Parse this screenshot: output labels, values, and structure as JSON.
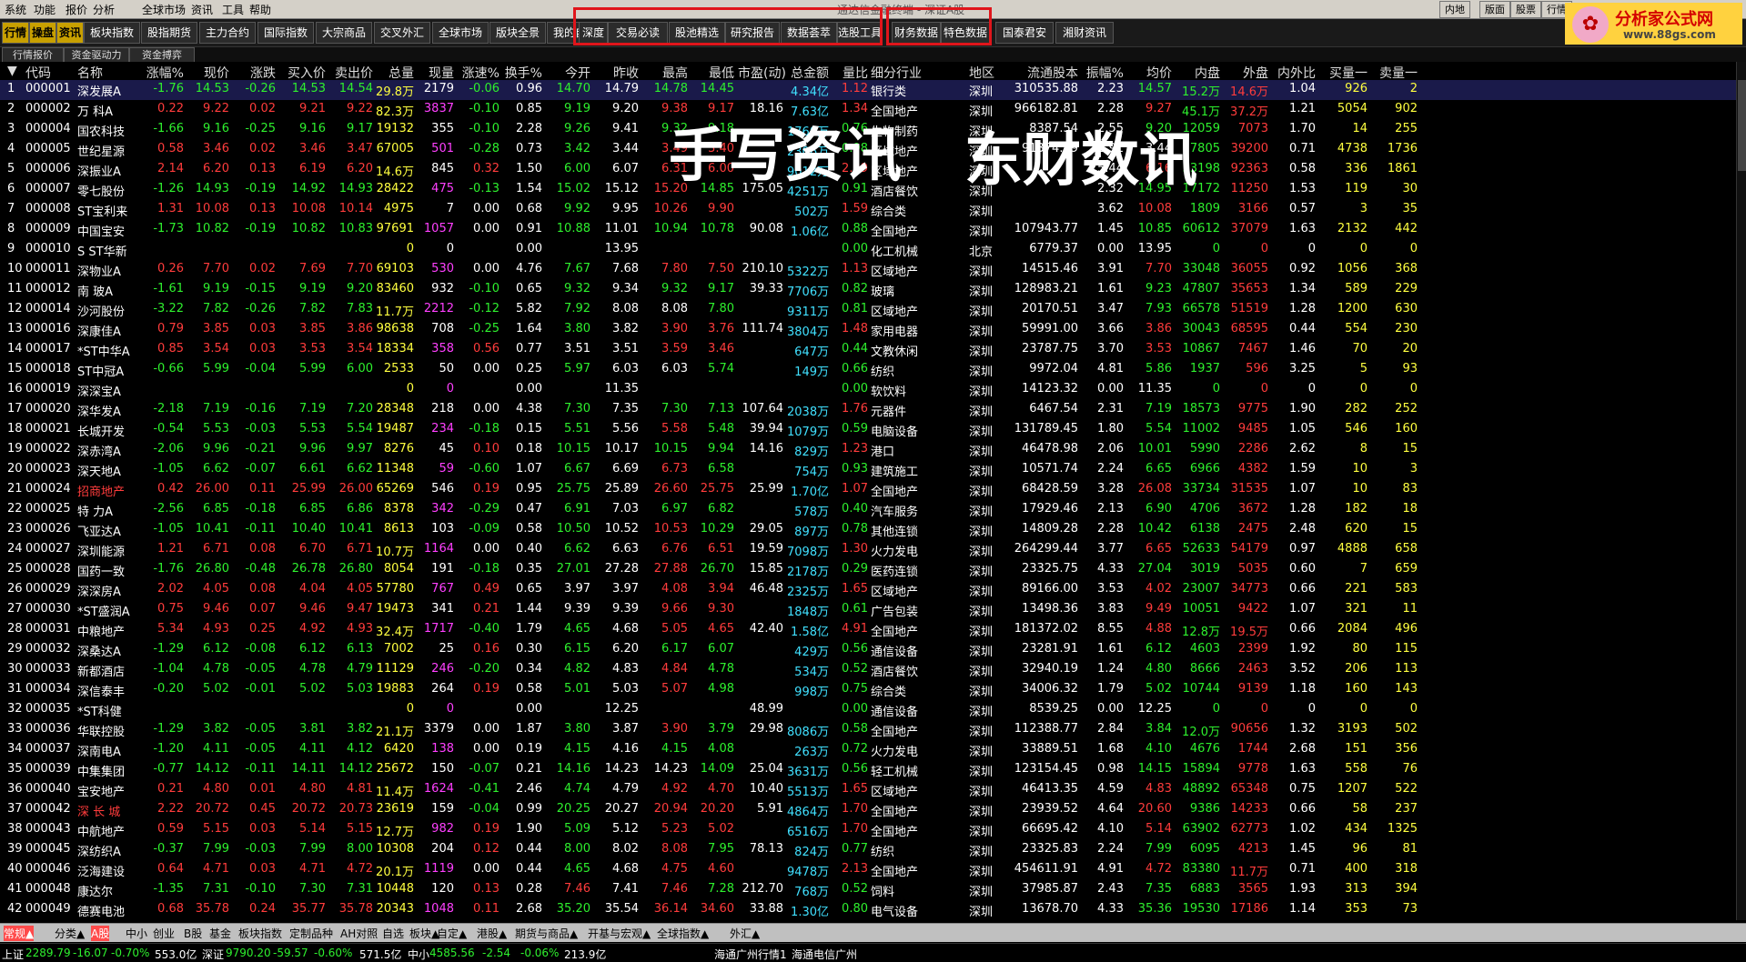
{
  "app": {
    "title": "通达信金融终端 - 深证A股"
  },
  "menu": [
    "系统",
    "功能",
    "报价",
    "分析",
    "全球市场",
    "资讯",
    "工具",
    "帮助"
  ],
  "window_buttons": [
    "内地手",
    "版面",
    "股票",
    "行情"
  ],
  "logo": {
    "text": "分析家公式网",
    "url": "www.88gs.com"
  },
  "toolbar": {
    "left": [
      "行情",
      "操盘",
      "资讯",
      "板块指数",
      "股指期货",
      "主力合约",
      "国际指数",
      "大宗商品",
      "交叉外汇",
      "全球市场",
      "版块全景",
      "我的自选"
    ],
    "box1": [
      "深度",
      "交易必读",
      "股池精选",
      "研究报告",
      "数据荟萃",
      "选股工具"
    ],
    "box2": [
      "财务数据",
      "特色数据"
    ],
    "right": [
      "国泰君安",
      "湘财资讯"
    ]
  },
  "subtabs": [
    "行情报价",
    "资金驱动力",
    "资金搏弈"
  ],
  "annotations": {
    "left": "手写资讯",
    "right": "东财数讯"
  },
  "columns": [
    "",
    "代码",
    "名称",
    "涨幅%",
    "现价",
    "涨跌",
    "买入价",
    "卖出价",
    "总量",
    "现量",
    "涨速%",
    "换手%",
    "今开",
    "昨收",
    "最高",
    "最低",
    "市盈(动)",
    "总金额",
    "量比",
    "细分行业",
    "地区",
    "流通股本",
    "振幅%",
    "均价",
    "内盘",
    "外盘",
    "内外比",
    "买量一",
    "卖量一"
  ],
  "rows": [
    [
      "1",
      "000001",
      "深发展A",
      "-1.76",
      "14.53",
      "-0.26",
      "14.53",
      "14.54",
      "29.8万",
      "2179",
      "-0.06",
      "0.96",
      "14.70",
      "14.79",
      "14.78",
      "14.45",
      "",
      "4.34亿",
      "1.12",
      "银行类",
      "深圳",
      "310535.88",
      "2.23",
      "14.57",
      "15.2万",
      "14.6万",
      "1.04",
      "926",
      "2"
    ],
    [
      "2",
      "000002",
      "万 科A",
      "0.22",
      "9.22",
      "0.02",
      "9.21",
      "9.22",
      "82.3万",
      "3837",
      "-0.10",
      "0.85",
      "9.19",
      "9.20",
      "9.38",
      "9.17",
      "18.16",
      "7.63亿",
      "1.34",
      "全国地产",
      "深圳",
      "966182.81",
      "2.28",
      "9.27",
      "45.1万",
      "37.2万",
      "1.21",
      "5054",
      "902"
    ],
    [
      "3",
      "000004",
      "国农科技",
      "-1.66",
      "9.16",
      "-0.25",
      "9.16",
      "9.17",
      "19132",
      "355",
      "-0.10",
      "2.28",
      "9.26",
      "9.41",
      "9.32",
      "9.18",
      "",
      "1760万",
      "0.76",
      "生物制药",
      "深圳",
      "8387.54",
      "2.55",
      "9.20",
      "12059",
      "7073",
      "1.70",
      "14",
      "255"
    ],
    [
      "4",
      "000005",
      "世纪星源",
      "0.58",
      "3.46",
      "0.02",
      "3.46",
      "3.47",
      "67005",
      "501",
      "-0.28",
      "0.73",
      "3.42",
      "3.44",
      "3.49",
      "3.40",
      "",
      "2306万",
      "0.98",
      "区域地产",
      "深圳",
      "91374.29",
      "2.91",
      "3.44",
      "27805",
      "39200",
      "0.71",
      "4738",
      "1736"
    ],
    [
      "5",
      "000006",
      "深振业A",
      "2.14",
      "6.20",
      "0.13",
      "6.19",
      "6.20",
      "14.6万",
      "845",
      "0.32",
      "1.50",
      "6.00",
      "6.07",
      "6.31",
      "6.00",
      "",
      "9012万",
      "2.39",
      "区域地产",
      "深圳",
      "",
      "5.44",
      "6.16",
      "53198",
      "92363",
      "0.58",
      "336",
      "1861"
    ],
    [
      "6",
      "000007",
      "零七股份",
      "-1.26",
      "14.93",
      "-0.19",
      "14.92",
      "14.93",
      "28422",
      "475",
      "-0.13",
      "1.54",
      "15.02",
      "15.12",
      "15.20",
      "14.85",
      "175.05",
      "4251万",
      "0.91",
      "酒店餐饮",
      "深圳",
      "",
      "2.32",
      "14.95",
      "17172",
      "11250",
      "1.53",
      "119",
      "30"
    ],
    [
      "7",
      "000008",
      "ST宝利来",
      "1.31",
      "10.08",
      "0.13",
      "10.08",
      "10.14",
      "4975",
      "7",
      "0.00",
      "0.68",
      "9.92",
      "9.95",
      "10.26",
      "9.90",
      "",
      "502万",
      "1.59",
      "综合类",
      "深圳",
      "",
      "3.62",
      "10.08",
      "1809",
      "3166",
      "0.57",
      "3",
      "35"
    ],
    [
      "8",
      "000009",
      "中国宝安",
      "-1.73",
      "10.82",
      "-0.19",
      "10.82",
      "10.83",
      "97691",
      "1057",
      "0.00",
      "0.91",
      "10.88",
      "11.01",
      "10.94",
      "10.78",
      "90.08",
      "1.06亿",
      "0.88",
      "全国地产",
      "深圳",
      "107943.77",
      "1.45",
      "10.85",
      "60612",
      "37079",
      "1.63",
      "2132",
      "442"
    ],
    [
      "9",
      "000010",
      "S ST华新",
      "",
      "",
      "",
      "",
      "",
      "0",
      "0",
      "",
      "0.00",
      "",
      "13.95",
      "",
      "",
      "",
      "",
      "0.00",
      "化工机械",
      "北京",
      "6779.37",
      "0.00",
      "13.95",
      "0",
      "0",
      "0",
      "0",
      "0"
    ],
    [
      "10",
      "000011",
      "深物业A",
      "0.26",
      "7.70",
      "0.02",
      "7.69",
      "7.70",
      "69103",
      "530",
      "0.00",
      "4.76",
      "7.67",
      "7.68",
      "7.80",
      "7.50",
      "210.10",
      "5322万",
      "1.13",
      "区域地产",
      "深圳",
      "14515.46",
      "3.91",
      "7.70",
      "33048",
      "36055",
      "0.92",
      "1056",
      "368"
    ],
    [
      "11",
      "000012",
      "南 玻A",
      "-1.61",
      "9.19",
      "-0.15",
      "9.19",
      "9.20",
      "83460",
      "932",
      "-0.10",
      "0.65",
      "9.32",
      "9.34",
      "9.32",
      "9.17",
      "39.33",
      "7706万",
      "0.82",
      "玻璃",
      "深圳",
      "128983.21",
      "1.61",
      "9.23",
      "47807",
      "35653",
      "1.34",
      "589",
      "229"
    ],
    [
      "12",
      "000014",
      "沙河股份",
      "-3.22",
      "7.82",
      "-0.26",
      "7.82",
      "7.83",
      "11.7万",
      "2212",
      "-0.12",
      "5.82",
      "7.92",
      "8.08",
      "8.08",
      "7.80",
      "",
      "9311万",
      "0.81",
      "区域地产",
      "深圳",
      "20170.51",
      "3.47",
      "7.93",
      "66578",
      "51519",
      "1.28",
      "1200",
      "630"
    ],
    [
      "13",
      "000016",
      "深康佳A",
      "0.79",
      "3.85",
      "0.03",
      "3.85",
      "3.86",
      "98638",
      "708",
      "-0.25",
      "1.64",
      "3.80",
      "3.82",
      "3.90",
      "3.76",
      "111.74",
      "3804万",
      "1.48",
      "家用电器",
      "深圳",
      "59991.00",
      "3.66",
      "3.86",
      "30043",
      "68595",
      "0.44",
      "554",
      "230"
    ],
    [
      "14",
      "000017",
      "*ST中华A",
      "0.85",
      "3.54",
      "0.03",
      "3.53",
      "3.54",
      "18334",
      "358",
      "0.56",
      "0.77",
      "3.51",
      "3.51",
      "3.59",
      "3.46",
      "",
      "647万",
      "0.44",
      "文教休闲",
      "深圳",
      "23787.75",
      "3.70",
      "3.53",
      "10867",
      "7467",
      "1.46",
      "70",
      "20"
    ],
    [
      "15",
      "000018",
      "ST中冠A",
      "-0.66",
      "5.99",
      "-0.04",
      "5.99",
      "6.00",
      "2533",
      "50",
      "0.00",
      "0.25",
      "5.97",
      "6.03",
      "6.03",
      "5.74",
      "",
      "149万",
      "0.66",
      "纺织",
      "深圳",
      "9972.04",
      "4.81",
      "5.86",
      "1937",
      "596",
      "3.25",
      "5",
      "93"
    ],
    [
      "16",
      "000019",
      "深深宝A",
      "",
      "",
      "",
      "",
      "",
      "0",
      "0",
      "",
      "0.00",
      "",
      "11.35",
      "",
      "",
      "",
      "",
      "0.00",
      "软饮料",
      "深圳",
      "14123.32",
      "0.00",
      "11.35",
      "0",
      "0",
      "0",
      "0",
      "0"
    ],
    [
      "17",
      "000020",
      "深华发A",
      "-2.18",
      "7.19",
      "-0.16",
      "7.19",
      "7.20",
      "28348",
      "218",
      "0.00",
      "4.38",
      "7.30",
      "7.35",
      "7.30",
      "7.13",
      "107.64",
      "2038万",
      "1.76",
      "元器件",
      "深圳",
      "6467.54",
      "2.31",
      "7.19",
      "18573",
      "9775",
      "1.90",
      "282",
      "252"
    ],
    [
      "18",
      "000021",
      "长城开发",
      "-0.54",
      "5.53",
      "-0.03",
      "5.53",
      "5.54",
      "19487",
      "234",
      "-0.18",
      "0.15",
      "5.51",
      "5.56",
      "5.58",
      "5.48",
      "39.94",
      "1079万",
      "0.59",
      "电脑设备",
      "深圳",
      "131789.45",
      "1.80",
      "5.54",
      "11002",
      "9485",
      "1.05",
      "546",
      "160"
    ],
    [
      "19",
      "000022",
      "深赤湾A",
      "-2.06",
      "9.96",
      "-0.21",
      "9.96",
      "9.97",
      "8276",
      "45",
      "0.10",
      "0.18",
      "10.15",
      "10.17",
      "10.15",
      "9.94",
      "14.16",
      "829万",
      "1.23",
      "港口",
      "深圳",
      "46478.98",
      "2.06",
      "10.01",
      "5990",
      "2286",
      "2.62",
      "8",
      "15"
    ],
    [
      "20",
      "000023",
      "深天地A",
      "-1.05",
      "6.62",
      "-0.07",
      "6.61",
      "6.62",
      "11348",
      "59",
      "-0.60",
      "1.07",
      "6.67",
      "6.69",
      "6.73",
      "6.58",
      "",
      "754万",
      "0.93",
      "建筑施工",
      "深圳",
      "10571.74",
      "2.24",
      "6.65",
      "6966",
      "4382",
      "1.59",
      "10",
      "3"
    ],
    [
      "21",
      "000024",
      "招商地产",
      "0.42",
      "26.00",
      "0.11",
      "25.99",
      "26.00",
      "65269",
      "546",
      "0.19",
      "0.95",
      "25.75",
      "25.89",
      "26.60",
      "25.75",
      "25.99",
      "1.70亿",
      "1.07",
      "全国地产",
      "深圳",
      "68428.59",
      "3.28",
      "26.08",
      "33734",
      "31535",
      "1.07",
      "10",
      "83"
    ],
    [
      "22",
      "000025",
      "特 力A",
      "-2.56",
      "6.85",
      "-0.18",
      "6.85",
      "6.86",
      "8378",
      "342",
      "-0.29",
      "0.47",
      "6.91",
      "7.03",
      "6.97",
      "6.82",
      "",
      "578万",
      "0.40",
      "汽车服务",
      "深圳",
      "17929.46",
      "2.13",
      "6.90",
      "4706",
      "3672",
      "1.28",
      "182",
      "18"
    ],
    [
      "23",
      "000026",
      "飞亚达A",
      "-1.05",
      "10.41",
      "-0.11",
      "10.40",
      "10.41",
      "8613",
      "103",
      "-0.09",
      "0.58",
      "10.50",
      "10.52",
      "10.53",
      "10.29",
      "29.05",
      "897万",
      "0.78",
      "其他连锁",
      "深圳",
      "14809.28",
      "2.28",
      "10.42",
      "6138",
      "2475",
      "2.48",
      "620",
      "15"
    ],
    [
      "24",
      "000027",
      "深圳能源",
      "1.21",
      "6.71",
      "0.08",
      "6.70",
      "6.71",
      "10.7万",
      "1164",
      "0.00",
      "0.40",
      "6.62",
      "6.63",
      "6.76",
      "6.51",
      "19.59",
      "7098万",
      "1.30",
      "火力发电",
      "深圳",
      "264299.44",
      "3.77",
      "6.65",
      "52633",
      "54179",
      "0.97",
      "4888",
      "658"
    ],
    [
      "25",
      "000028",
      "国药一致",
      "-1.76",
      "26.80",
      "-0.48",
      "26.78",
      "26.80",
      "8054",
      "191",
      "-0.18",
      "0.35",
      "27.01",
      "27.28",
      "27.88",
      "26.70",
      "15.85",
      "2178万",
      "0.29",
      "医药连锁",
      "深圳",
      "23325.75",
      "4.33",
      "27.04",
      "3019",
      "5035",
      "0.60",
      "7",
      "659"
    ],
    [
      "26",
      "000029",
      "深深房A",
      "2.02",
      "4.05",
      "0.08",
      "4.04",
      "4.05",
      "57780",
      "767",
      "0.49",
      "0.65",
      "3.97",
      "3.97",
      "4.08",
      "3.94",
      "46.48",
      "2325万",
      "1.65",
      "区域地产",
      "深圳",
      "89166.00",
      "3.53",
      "4.02",
      "23007",
      "34773",
      "0.66",
      "221",
      "583"
    ],
    [
      "27",
      "000030",
      "*ST盛润A",
      "0.75",
      "9.46",
      "0.07",
      "9.46",
      "9.47",
      "19473",
      "341",
      "0.21",
      "1.44",
      "9.39",
      "9.39",
      "9.66",
      "9.30",
      "",
      "1848万",
      "0.61",
      "广告包装",
      "深圳",
      "13498.36",
      "3.83",
      "9.49",
      "10051",
      "9422",
      "1.07",
      "321",
      "11"
    ],
    [
      "28",
      "000031",
      "中粮地产",
      "5.34",
      "4.93",
      "0.25",
      "4.92",
      "4.93",
      "32.4万",
      "1717",
      "-0.40",
      "1.79",
      "4.65",
      "4.68",
      "5.05",
      "4.65",
      "42.40",
      "1.58亿",
      "4.91",
      "全国地产",
      "深圳",
      "181372.02",
      "8.55",
      "4.88",
      "12.8万",
      "19.5万",
      "0.66",
      "2084",
      "496"
    ],
    [
      "29",
      "000032",
      "深桑达A",
      "-1.29",
      "6.12",
      "-0.08",
      "6.12",
      "6.13",
      "7002",
      "25",
      "0.16",
      "0.30",
      "6.15",
      "6.20",
      "6.17",
      "6.07",
      "",
      "429万",
      "0.56",
      "通信设备",
      "深圳",
      "23281.91",
      "1.61",
      "6.12",
      "4603",
      "2399",
      "1.92",
      "80",
      "115"
    ],
    [
      "30",
      "000033",
      "新都酒店",
      "-1.04",
      "4.78",
      "-0.05",
      "4.78",
      "4.79",
      "11129",
      "246",
      "-0.20",
      "0.34",
      "4.82",
      "4.83",
      "4.84",
      "4.78",
      "",
      "534万",
      "0.52",
      "酒店餐饮",
      "深圳",
      "32940.19",
      "1.24",
      "4.80",
      "8666",
      "2463",
      "3.52",
      "206",
      "113"
    ],
    [
      "31",
      "000034",
      "深信泰丰",
      "-0.20",
      "5.02",
      "-0.01",
      "5.02",
      "5.03",
      "19883",
      "264",
      "0.19",
      "0.58",
      "5.01",
      "5.03",
      "5.07",
      "4.98",
      "",
      "998万",
      "0.75",
      "综合类",
      "深圳",
      "34006.32",
      "1.79",
      "5.02",
      "10744",
      "9139",
      "1.18",
      "160",
      "143"
    ],
    [
      "32",
      "000035",
      "*ST科健",
      "",
      "",
      "",
      "",
      "",
      "0",
      "0",
      "",
      "0.00",
      "",
      "12.25",
      "",
      "",
      "48.99",
      "",
      "0.00",
      "通信设备",
      "深圳",
      "8539.25",
      "0.00",
      "12.25",
      "0",
      "0",
      "0",
      "0",
      "0"
    ],
    [
      "33",
      "000036",
      "华联控股",
      "-1.29",
      "3.82",
      "-0.05",
      "3.81",
      "3.82",
      "21.1万",
      "3379",
      "0.00",
      "1.87",
      "3.80",
      "3.87",
      "3.90",
      "3.79",
      "29.98",
      "8086万",
      "0.58",
      "全国地产",
      "深圳",
      "112388.77",
      "2.84",
      "3.84",
      "12.0万",
      "90656",
      "1.32",
      "3193",
      "502"
    ],
    [
      "34",
      "000037",
      "深南电A",
      "-1.20",
      "4.11",
      "-0.05",
      "4.11",
      "4.12",
      "6420",
      "138",
      "0.00",
      "0.19",
      "4.15",
      "4.16",
      "4.15",
      "4.08",
      "",
      "263万",
      "0.72",
      "火力发电",
      "深圳",
      "33889.51",
      "1.68",
      "4.10",
      "4676",
      "1744",
      "2.68",
      "151",
      "356"
    ],
    [
      "35",
      "000039",
      "中集集团",
      "-0.77",
      "14.12",
      "-0.11",
      "14.11",
      "14.12",
      "25672",
      "150",
      "-0.07",
      "0.21",
      "14.16",
      "14.23",
      "14.23",
      "14.09",
      "25.04",
      "3631万",
      "0.56",
      "轻工机械",
      "深圳",
      "123154.45",
      "0.98",
      "14.15",
      "15894",
      "9778",
      "1.63",
      "558",
      "76"
    ],
    [
      "36",
      "000040",
      "宝安地产",
      "0.21",
      "4.80",
      "0.01",
      "4.80",
      "4.81",
      "11.4万",
      "1624",
      "-0.41",
      "2.46",
      "4.74",
      "4.79",
      "4.92",
      "4.70",
      "10.40",
      "5513万",
      "1.65",
      "区域地产",
      "深圳",
      "46413.35",
      "4.59",
      "4.83",
      "48892",
      "65348",
      "0.75",
      "1207",
      "522"
    ],
    [
      "37",
      "000042",
      "深 长 城",
      "2.22",
      "20.72",
      "0.45",
      "20.72",
      "20.73",
      "23619",
      "159",
      "-0.04",
      "0.99",
      "20.25",
      "20.27",
      "20.94",
      "20.20",
      "5.91",
      "4864万",
      "1.70",
      "全国地产",
      "深圳",
      "23939.52",
      "4.64",
      "20.60",
      "9386",
      "14233",
      "0.66",
      "58",
      "237"
    ],
    [
      "38",
      "000043",
      "中航地产",
      "0.59",
      "5.15",
      "0.03",
      "5.14",
      "5.15",
      "12.7万",
      "982",
      "0.19",
      "1.90",
      "5.09",
      "5.12",
      "5.23",
      "5.02",
      "",
      "6516万",
      "1.70",
      "全国地产",
      "深圳",
      "66695.42",
      "4.10",
      "5.14",
      "63902",
      "62773",
      "1.02",
      "434",
      "1325"
    ],
    [
      "39",
      "000045",
      "深纺织A",
      "-0.37",
      "7.99",
      "-0.03",
      "7.99",
      "8.00",
      "10308",
      "204",
      "0.12",
      "0.44",
      "8.00",
      "8.02",
      "8.08",
      "7.95",
      "78.13",
      "824万",
      "0.77",
      "纺织",
      "深圳",
      "23325.83",
      "2.24",
      "7.99",
      "6095",
      "4213",
      "1.45",
      "96",
      "81"
    ],
    [
      "40",
      "000046",
      "泛海建设",
      "0.64",
      "4.71",
      "0.03",
      "4.71",
      "4.72",
      "20.1万",
      "1119",
      "0.00",
      "0.44",
      "4.65",
      "4.68",
      "4.75",
      "4.60",
      "",
      "9478万",
      "2.13",
      "全国地产",
      "深圳",
      "454611.91",
      "4.91",
      "4.72",
      "83380",
      "11.7万",
      "0.71",
      "400",
      "318"
    ],
    [
      "41",
      "000048",
      "康达尔",
      "-1.35",
      "7.31",
      "-0.10",
      "7.30",
      "7.31",
      "10448",
      "120",
      "0.13",
      "0.28",
      "7.46",
      "7.41",
      "7.46",
      "7.28",
      "212.70",
      "768万",
      "0.52",
      "饲料",
      "深圳",
      "37985.87",
      "2.43",
      "7.35",
      "6883",
      "3565",
      "1.93",
      "313",
      "394"
    ],
    [
      "42",
      "000049",
      "德赛电池",
      "0.68",
      "35.78",
      "0.24",
      "35.77",
      "35.78",
      "20343",
      "1048",
      "0.11",
      "2.68",
      "35.20",
      "35.54",
      "36.14",
      "34.60",
      "33.88",
      "1.30亿",
      "0.80",
      "电气设备",
      "深圳",
      "13678.70",
      "4.33",
      "35.36",
      "19530",
      "17186",
      "1.14",
      "353",
      "73"
    ]
  ],
  "bottom_tabs": [
    "常规▲",
    "分类▲",
    "A股",
    "中小",
    "创业",
    "B股",
    "基金",
    "板块指数",
    "定制品种",
    "AH对照",
    "自选",
    "板块▲",
    "自定▲",
    "港股▲",
    "期货与商品▲",
    "开基与宏观▲",
    "全球指数▲",
    "外汇▲"
  ],
  "status": {
    "sh": {
      "label": "上证",
      "value": "2289.79",
      "chg": "-16.07",
      "pct": "-0.70%",
      "amt": "553.0亿"
    },
    "sz": {
      "label": "深证",
      "value": "9790.20",
      "chg": "-59.57",
      "pct": "-0.60%",
      "amt": "571.5亿"
    },
    "sme": {
      "label": "中小",
      "value": "4585.56",
      "chg": "-2.54",
      "pct": "-0.06%",
      "amt": "213.9亿"
    },
    "server1": "海通广州行情1",
    "server2": "海通电信广州"
  }
}
